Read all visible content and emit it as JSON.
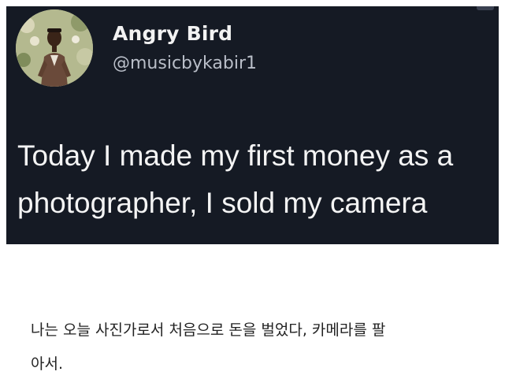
{
  "tweet": {
    "display_name": "Angry Bird",
    "handle": "@musicbykabir1",
    "text_lines": [
      "Today I made my first money as a",
      "photographer, I sold my camera"
    ]
  },
  "caption": {
    "lines": [
      "나는 오늘 사진가로서 처음으로 돈을 벌었다, 카메라를 팔",
      "아서."
    ]
  },
  "colors": {
    "card_background": "#151a24",
    "name_color": "#f2f2f2",
    "handle_color": "#b9bec8",
    "caption_color": "#222222"
  },
  "icons": {
    "avatar": "profile-photo"
  }
}
